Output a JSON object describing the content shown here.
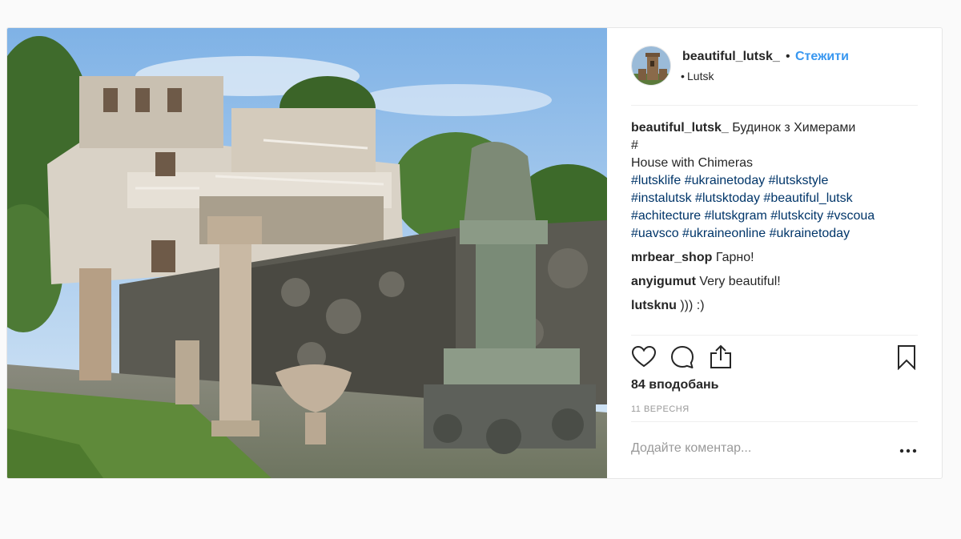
{
  "post": {
    "author": {
      "username": "beautiful_lutsk_",
      "follow_label": "Стежити",
      "separator": "•",
      "location": "Lutsk"
    },
    "caption": {
      "username": "beautiful_lutsk_",
      "title": "Будинок з Химерами",
      "hash": "#",
      "subtitle": "House with Chimeras",
      "tag_lines": [
        "#lutsklife #ukrainetoday #lutskstyle",
        "#instalutsk #lutsktoday #beautiful_lutsk",
        "#achitecture #lutskgram #lutskcity #vscoua",
        "#uavsco #ukraineonline #ukrainetoday"
      ]
    },
    "comments": [
      {
        "username": "mrbear_shop",
        "text": "Гарно!"
      },
      {
        "username": "anyigumut",
        "text": "Very beautiful!"
      },
      {
        "username": "lutsknu",
        "text": "))) :)"
      }
    ],
    "likes": "84 вподобань",
    "date": "11 ВЕРЕСНЯ",
    "add_comment_placeholder": "Додайте коментар...",
    "icons": {
      "like": "heart-icon",
      "comment": "comment-bubble-icon",
      "share": "share-icon",
      "save": "bookmark-icon",
      "more": "more-dots-icon"
    }
  }
}
